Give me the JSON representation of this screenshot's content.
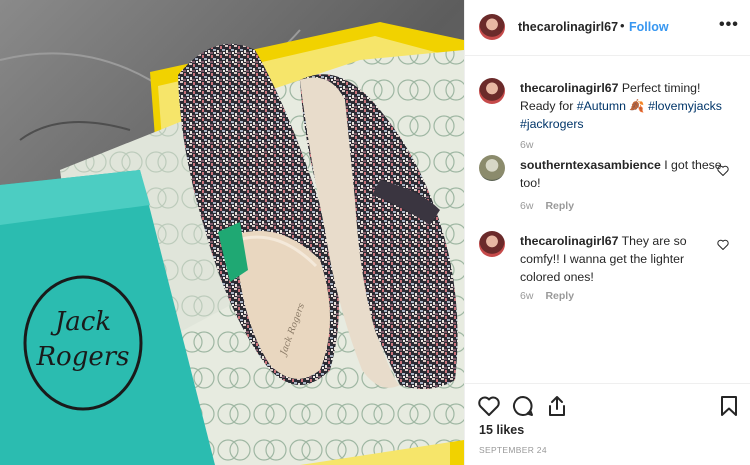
{
  "photo": {
    "brand_text_1": "Jack",
    "brand_text_2": "Rogers",
    "insole_text": "Jack Rogers"
  },
  "post": {
    "username": "thecarolinagirl67",
    "separator": "•",
    "follow_label": "Follow",
    "more_label": "•••"
  },
  "comments": [
    {
      "username": "thecarolinagirl67",
      "text_before": "Perfect timing! Ready for ",
      "tag1": "#Autumn",
      "emoji": " 🍂 ",
      "tag2": "#lovemyjacks",
      "tag3": "#jackrogers",
      "time": "6w"
    },
    {
      "username": "southerntexasambience",
      "text": "I got these too!",
      "time": "6w",
      "reply_label": "Reply"
    },
    {
      "username": "thecarolinagirl67",
      "text": "They are so comfy!! I wanna get the lighter colored ones!",
      "time": "6w",
      "reply_label": "Reply"
    }
  ],
  "footer": {
    "likes": "15 likes",
    "date": "SEPTEMBER 24"
  },
  "icons": {
    "like": "heart-icon",
    "comment": "comment-bubble-icon",
    "share": "share-upload-icon",
    "save": "bookmark-icon",
    "more": "more-options-icon"
  },
  "colors": {
    "link_blue": "#3897f0",
    "hashtag_navy": "#003569",
    "meta_gray": "#999999",
    "box_teal": "#2bbcb0",
    "box_yellow": "#f1d200"
  }
}
